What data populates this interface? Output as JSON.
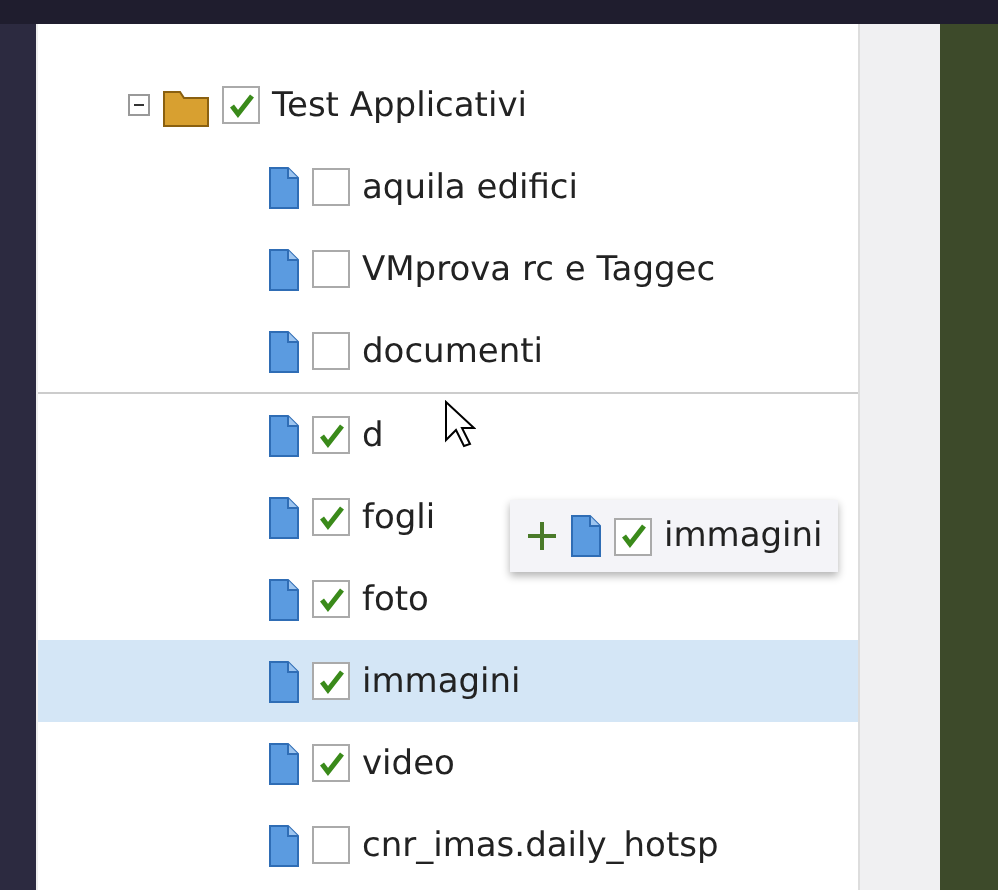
{
  "tree": {
    "label": "Test Applicativi",
    "checked": true,
    "expanded": true,
    "children": [
      {
        "label": "aquila edifici",
        "checked": false,
        "selected": false
      },
      {
        "label": "VMprova rc e Taggec",
        "checked": false,
        "selected": false
      },
      {
        "label": "documenti",
        "checked": false,
        "selected": false
      },
      {
        "label": "d",
        "checked": true,
        "selected": false
      },
      {
        "label": "fogli",
        "checked": true,
        "selected": false
      },
      {
        "label": "foto",
        "checked": true,
        "selected": false
      },
      {
        "label": "immagini",
        "checked": true,
        "selected": true
      },
      {
        "label": "video",
        "checked": true,
        "selected": false
      },
      {
        "label": "cnr_imas.daily_hotsp",
        "checked": false,
        "selected": false
      }
    ]
  },
  "drag_ghost": {
    "label": "immagini",
    "checked": true
  }
}
